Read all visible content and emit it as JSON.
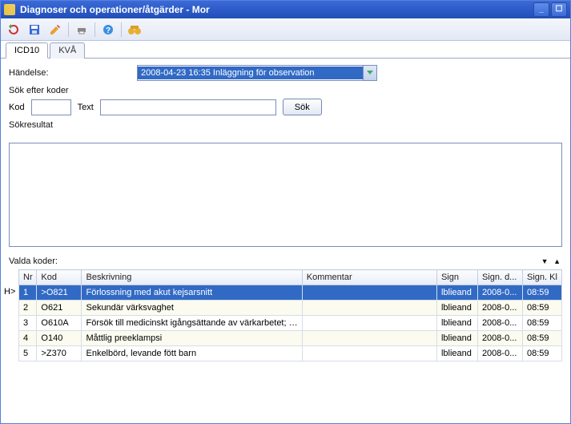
{
  "window": {
    "title": "Diagnoser och operationer/åtgärder - Mor"
  },
  "tabs": {
    "icd10": "ICD10",
    "kva": "KVÅ"
  },
  "labels": {
    "handelse": "Händelse:",
    "sok_efter": "Sök efter koder",
    "kod": "Kod",
    "text": "Text",
    "sok_btn": "Sök",
    "sokresultat": "Sökresultat",
    "valda_koder": "Valda koder:",
    "h_marker": "H>"
  },
  "handelse": {
    "selected": "2008-04-23 16:35 Inläggning för observation"
  },
  "columns": {
    "nr": "Nr",
    "kod": "Kod",
    "beskrivning": "Beskrivning",
    "kommentar": "Kommentar",
    "sign": "Sign",
    "sign_d": "Sign. d...",
    "sign_kl": "Sign. Kl"
  },
  "rows": [
    {
      "nr": "1",
      "kod": ">O821",
      "besk": "Förlossning med akut kejsarsnitt",
      "komm": "",
      "sign": "lblieand",
      "signd": "2008-0...",
      "signkl": "08:59",
      "selected": true
    },
    {
      "nr": "2",
      "kod": "O621",
      "besk": "Sekundär värksvaghet",
      "komm": "",
      "sign": "lblieand",
      "signd": "2008-0...",
      "signkl": "08:59"
    },
    {
      "nr": "3",
      "kod": "O610A",
      "besk": "Försök till medicinskt igångsättande av värkarbetet; f...",
      "komm": "",
      "sign": "lblieand",
      "signd": "2008-0...",
      "signkl": "08:59"
    },
    {
      "nr": "4",
      "kod": "O140",
      "besk": "Måttlig preeklampsi",
      "komm": "",
      "sign": "lblieand",
      "signd": "2008-0...",
      "signkl": "08:59"
    },
    {
      "nr": "5",
      "kod": ">Z370",
      "besk": "Enkelbörd, levande fött barn",
      "komm": "",
      "sign": "lblieand",
      "signd": "2008-0...",
      "signkl": "08:59"
    }
  ]
}
